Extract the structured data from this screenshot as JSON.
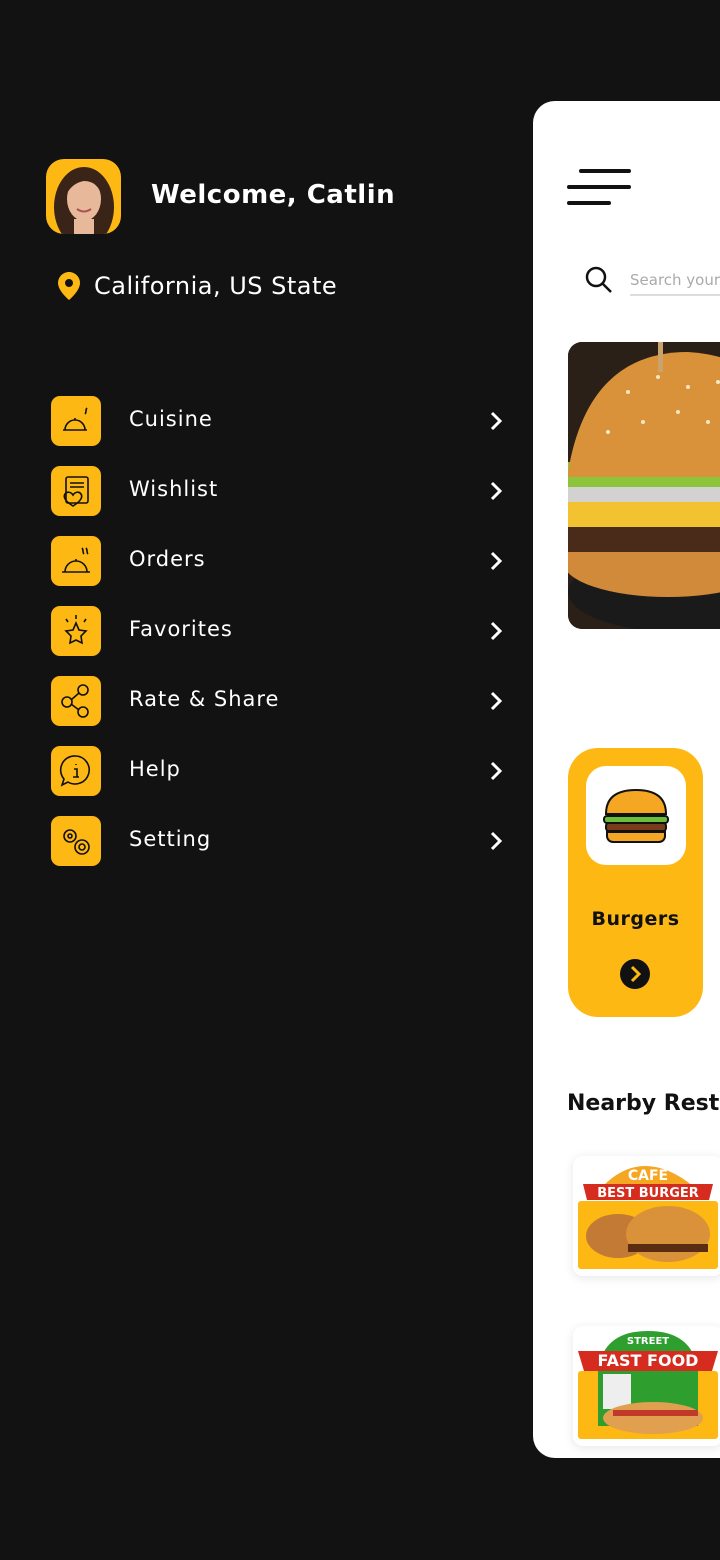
{
  "colors": {
    "accent": "#FDB813",
    "background": "#121212",
    "panel": "#FFFFFF"
  },
  "user": {
    "welcome": "Welcome, Catlin",
    "location": "California, US State"
  },
  "menu": [
    {
      "label": "Cuisine",
      "icon": "cuisine-cloche-icon"
    },
    {
      "label": "Wishlist",
      "icon": "wishlist-heart-icon"
    },
    {
      "label": "Orders",
      "icon": "orders-cloche-icon"
    },
    {
      "label": "Favorites",
      "icon": "star-icon"
    },
    {
      "label": "Rate & Share",
      "icon": "share-icon"
    },
    {
      "label": "Help",
      "icon": "info-icon"
    },
    {
      "label": "Setting",
      "icon": "gears-icon"
    }
  ],
  "main": {
    "search_placeholder": "Search your",
    "category": {
      "label": "Burgers"
    },
    "nearby_title": "Nearby Resta",
    "restaurants": [
      {
        "logo_top": "CAFE",
        "logo_main": "BEST BURGER"
      },
      {
        "logo_top": "STREET",
        "logo_main": "FAST FOOD"
      }
    ]
  }
}
